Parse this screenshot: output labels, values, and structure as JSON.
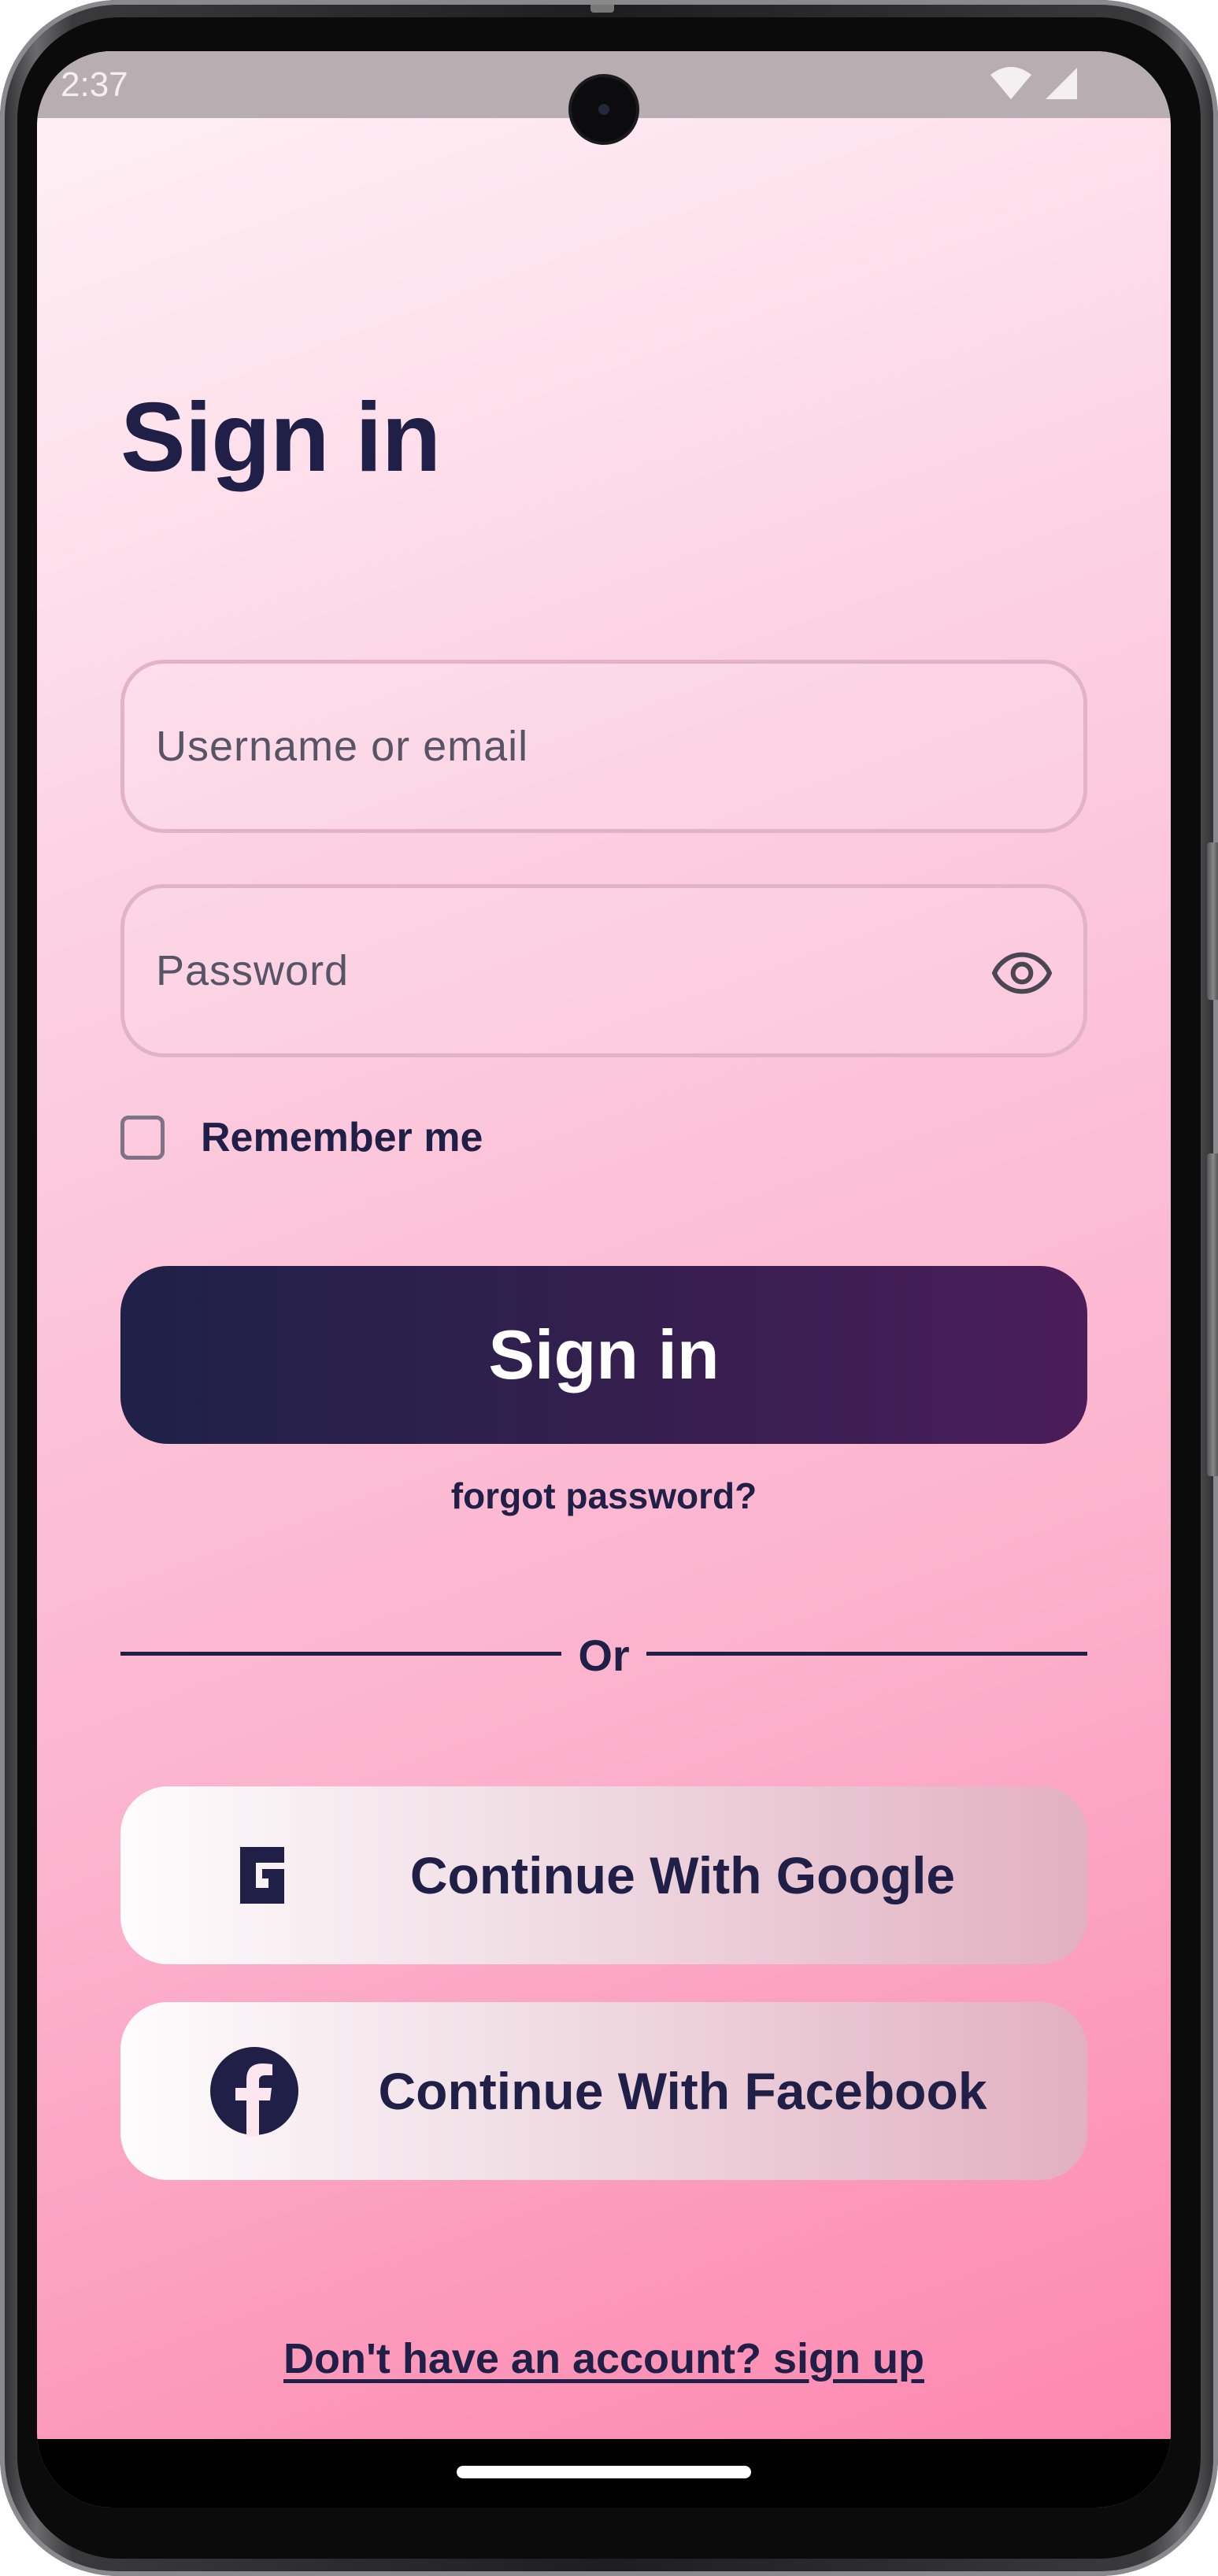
{
  "status_bar": {
    "time": "2:37",
    "icons": [
      "wifi-icon",
      "cell-signal-icon"
    ]
  },
  "page": {
    "title": "Sign in"
  },
  "form": {
    "username_placeholder": "Username or email",
    "username_value": "",
    "password_placeholder": "Password",
    "password_value": "",
    "password_toggle_icon": "eye-icon",
    "remember_label": "Remember me",
    "remember_checked": false,
    "submit_label": "Sign in",
    "forgot_label": "forgot password?"
  },
  "divider": {
    "label": "Or"
  },
  "social": {
    "google_label": "Continue With Google",
    "google_icon": "google-icon",
    "facebook_label": "Continue With Facebook",
    "facebook_icon": "facebook-icon"
  },
  "footer": {
    "signup_label": "Don't have an account? sign up"
  },
  "colors": {
    "primary_text": "#1f1f47",
    "button_gradient_start": "#1f2148",
    "button_gradient_end": "#4b1d5a",
    "background_top": "#fff2f6",
    "background_bottom": "#fd85ad",
    "field_border": "#e2b3c4"
  }
}
